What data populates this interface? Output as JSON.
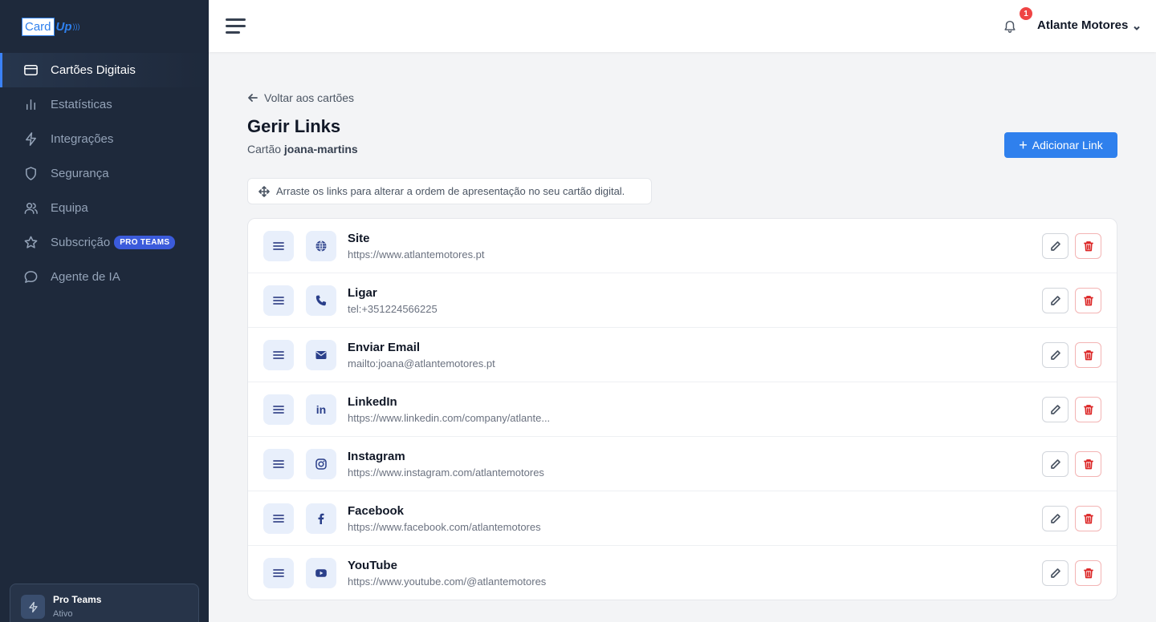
{
  "brand": {
    "logo_card": "Card",
    "logo_up": "Up"
  },
  "sidebar": {
    "items": [
      {
        "label": "Cartões Digitais",
        "icon": "card-icon",
        "active": true
      },
      {
        "label": "Estatísticas",
        "icon": "bar-chart-icon"
      },
      {
        "label": "Integrações",
        "icon": "lightning-icon"
      },
      {
        "label": "Segurança",
        "icon": "shield-icon"
      },
      {
        "label": "Equipa",
        "icon": "users-icon"
      },
      {
        "label": "Subscrição",
        "icon": "star-icon",
        "badge": "PRO TEAMS"
      },
      {
        "label": "Agente de IA",
        "icon": "chat-icon"
      }
    ],
    "plan": {
      "name": "Pro Teams",
      "status": "Ativo"
    }
  },
  "header": {
    "notification_count": "1",
    "user_name": "Atlante Motores"
  },
  "main": {
    "back_label": "Voltar aos cartões",
    "title": "Gerir Links",
    "subtitle_prefix": "Cartão",
    "card_slug": "joana-martins",
    "add_button": "Adicionar Link",
    "hint": "Arraste os links para alterar a ordem de apresentação no seu cartão digital.",
    "links": [
      {
        "title": "Site",
        "url": "https://www.atlantemotores.pt",
        "icon": "globe-icon"
      },
      {
        "title": "Ligar",
        "url": "tel:+351224566225",
        "icon": "phone-icon"
      },
      {
        "title": "Enviar Email",
        "url": "mailto:joana@atlantemotores.pt",
        "icon": "envelope-icon"
      },
      {
        "title": "LinkedIn",
        "url": "https://www.linkedin.com/company/atlante...",
        "icon": "linkedin-icon"
      },
      {
        "title": "Instagram",
        "url": "https://www.instagram.com/atlantemotores",
        "icon": "instagram-icon"
      },
      {
        "title": "Facebook",
        "url": "https://www.facebook.com/atlantemotores",
        "icon": "facebook-icon"
      },
      {
        "title": "YouTube",
        "url": "https://www.youtube.com/@atlantemotores",
        "icon": "youtube-icon"
      }
    ]
  },
  "colors": {
    "sidebar_bg": "#1e293b",
    "accent": "#2f80ed",
    "danger": "#dc2626",
    "badge": "#3b5bdb"
  }
}
